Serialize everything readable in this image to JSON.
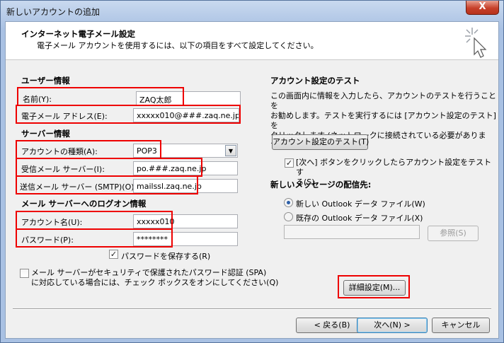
{
  "window": {
    "title": "新しいアカウントの追加",
    "close_glyph": "X"
  },
  "header": {
    "title": "インターネット電子メール設定",
    "subtitle": "電子メール アカウントを使用するには、以下の項目をすべて設定してください。"
  },
  "user_info": {
    "heading": "ユーザー情報",
    "name_label": "名前(Y):",
    "name_value": "ZAQ太郎",
    "email_label": "電子メール アドレス(E):",
    "email_value": "xxxxx010@###.zaq.ne.jp"
  },
  "server_info": {
    "heading": "サーバー情報",
    "account_type_label": "アカウントの種類(A):",
    "account_type_value": "POP3",
    "incoming_label": "受信メール サーバー(I):",
    "incoming_value": "po.###.zaq.ne.jp",
    "outgoing_label": "送信メール サーバー (SMTP)(O):",
    "outgoing_value": "mailssl.zaq.ne.jp"
  },
  "logon_info": {
    "heading": "メール サーバーへのログオン情報",
    "account_name_label": "アカウント名(U):",
    "account_name_value": "xxxxx010",
    "password_label": "パスワード(P):",
    "password_value": "********",
    "remember_password_label": "パスワードを保存する(R)",
    "remember_password_checked": true,
    "spa_label_line1": "メール サーバーがセキュリティで保護されたパスワード認証 (SPA)",
    "spa_label_line2": "に対応している場合には、チェック ボックスをオンにしてください(Q)",
    "spa_checked": false
  },
  "test_section": {
    "heading": "アカウント設定のテスト",
    "description_line1": "この画面内に情報を入力したら、アカウントのテストを行うことを",
    "description_line2": "お勧めします。テストを実行するには [アカウント設定のテスト] を",
    "description_line3": "クリックします (ネットワークに接続されている必要があります)。",
    "test_button": "アカウント設定のテスト(T)",
    "auto_test_line1": "[次へ] ボタンをクリックしたらアカウント設定をテストす",
    "auto_test_line2": "る(S)",
    "auto_test_checked": true
  },
  "delivery": {
    "heading": "新しいメッセージの配信先:",
    "new_pst_label": "新しい Outlook データ ファイル(W)",
    "existing_pst_label": "既存の Outlook データ ファイル(X)",
    "selected": "new",
    "browse_button": "参照(S)"
  },
  "buttons": {
    "more_settings": "詳細設定(M)...",
    "back": "< 戻る(B)",
    "next": "次へ(N) >",
    "cancel": "キャンセル"
  },
  "colors": {
    "highlight": "#e00000",
    "close_button": "#c7402a"
  },
  "icons": {
    "check": "✓",
    "dropdown": "▼",
    "wizard": "sparkle-cursor-icon"
  }
}
